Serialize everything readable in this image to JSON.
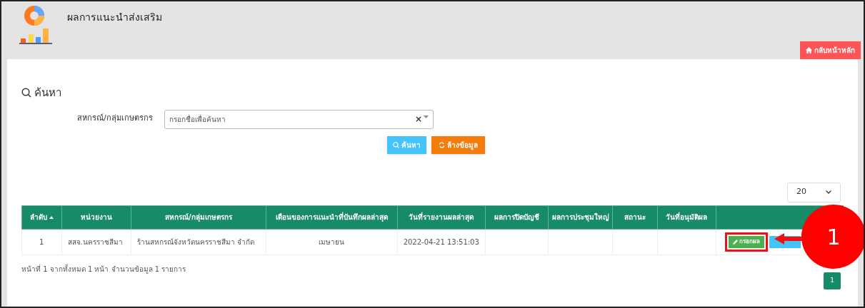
{
  "header": {
    "title": "ผลการแนะนำส่งเสริม",
    "home_button": "กลับหน้าหลัก"
  },
  "search": {
    "title": "ค้นหา",
    "field_label": "สหกรณ์/กลุ่มเกษตรกร",
    "placeholder": "กรอกชื่อเพื่อค้นหา",
    "clear": "×",
    "search_button": "ค้นหา",
    "reset_button": "ล้างข้อมูล"
  },
  "page_size": "20",
  "table": {
    "columns": [
      {
        "label": "ลำดับ",
        "sorted": true
      },
      {
        "label": "หน่วยงาน",
        "sorted": false
      },
      {
        "label": "สหกรณ์/กลุ่มเกษตรกร",
        "sorted": false
      },
      {
        "label": "เดือนของการแนะนำที่บันทึกผลล่าสุด",
        "sorted": false
      },
      {
        "label": "วันที่รายงานผลล่าสุด",
        "sorted": false
      },
      {
        "label": "ผลการปิดบัญชี",
        "sorted": false
      },
      {
        "label": "ผลการประชุมใหญ่",
        "sorted": false
      },
      {
        "label": "สถานะ",
        "sorted": false
      },
      {
        "label": "วันที่อนุมัติผล",
        "sorted": false
      },
      {
        "sorted": false
      }
    ],
    "rows": [
      {
        "cells": [
          "1",
          "สสจ.นครราชสีมา",
          "ร้านสหกรณ์จังหวัดนครราชสีมา จำกัด",
          "เมษายน",
          "2022-04-21 13:51:03"
        ],
        "action": "กรอกผล"
      }
    ]
  },
  "summary": "หน้าที่ 1 จากทั้งหมด 1 หน้า จำนวนข้อมูล 1 รายการ",
  "pages": [
    {
      "label": "1",
      "selected": true
    }
  ],
  "callout": {
    "number": "1"
  }
}
